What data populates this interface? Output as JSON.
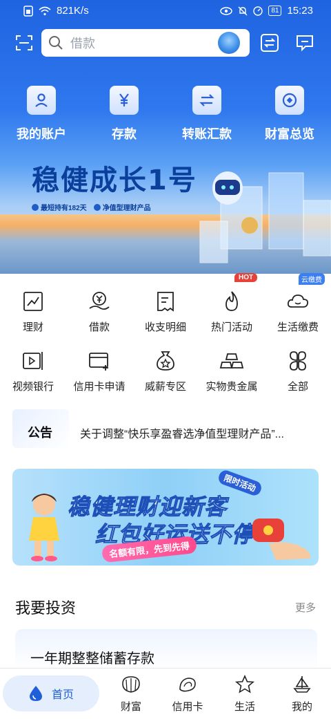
{
  "status_bar": {
    "speed": "821K/s",
    "battery": "81",
    "time": "15:23"
  },
  "search": {
    "placeholder": "借款"
  },
  "quick_actions": [
    {
      "label": "我的账户",
      "icon": "person-icon"
    },
    {
      "label": "存款",
      "icon": "yuan-icon"
    },
    {
      "label": "转账汇款",
      "icon": "transfer-icon"
    },
    {
      "label": "财富总览",
      "icon": "wealth-icon"
    }
  ],
  "hero_banner": {
    "title": "稳健成长1号",
    "tag1": "最短持有182天",
    "tag2": "净值型理财产品"
  },
  "menu": {
    "row1": [
      {
        "label": "理财",
        "icon": "chart-icon"
      },
      {
        "label": "借款",
        "icon": "loan-icon"
      },
      {
        "label": "收支明细",
        "icon": "ledger-icon"
      },
      {
        "label": "热门活动",
        "icon": "flame-icon"
      },
      {
        "label": "生活缴费",
        "icon": "cloud-icon"
      }
    ],
    "row2": [
      {
        "label": "视频银行",
        "icon": "video-icon"
      },
      {
        "label": "信用卡申请",
        "icon": "credit-card-add-icon"
      },
      {
        "label": "威薪专区",
        "icon": "money-bag-icon"
      },
      {
        "label": "实物贵金属",
        "icon": "gold-bars-icon"
      },
      {
        "label": "全部",
        "icon": "grid-icon"
      }
    ],
    "hot_badge": "HOT",
    "yun_badge": "云缴费"
  },
  "notice": {
    "label": "公告",
    "text": "关于调整“快乐享盈睿选净值型理财产品”..."
  },
  "promo": {
    "line1": "稳健理财迎新客",
    "line2": "红包好运送不停",
    "sub": "名额有限，先到先得",
    "limit": "限时活动"
  },
  "invest": {
    "title": "我要投资",
    "more": "更多",
    "product": "一年期整整储蓄存款"
  },
  "bottom_nav": {
    "home": "首页",
    "wealth": "财富",
    "credit": "信用卡",
    "life": "生活",
    "mine": "我的"
  },
  "colors": {
    "brand_blue": "#1f63e0",
    "hot_red": "#e8413a",
    "nav_active": "#1e5fd9"
  }
}
